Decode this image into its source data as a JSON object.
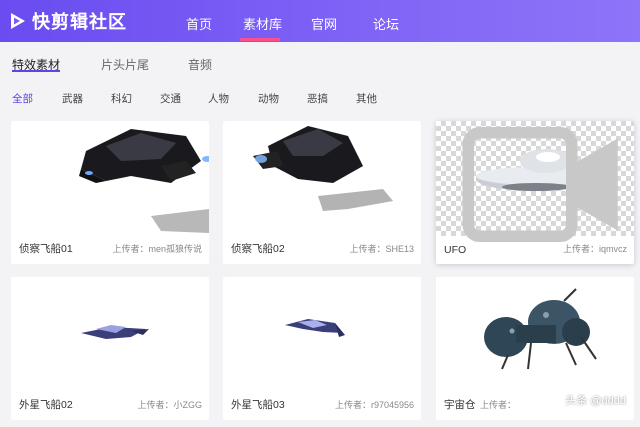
{
  "header": {
    "logo_text": "快剪辑社区",
    "nav": [
      {
        "label": "首页"
      },
      {
        "label": "素材库"
      },
      {
        "label": "官网"
      },
      {
        "label": "论坛"
      }
    ],
    "active_nav": "素材库"
  },
  "tabs": [
    {
      "label": "特效素材"
    },
    {
      "label": "片头片尾"
    },
    {
      "label": "音频"
    }
  ],
  "filters": [
    {
      "label": "全部"
    },
    {
      "label": "武器"
    },
    {
      "label": "科幻"
    },
    {
      "label": "交通"
    },
    {
      "label": "人物"
    },
    {
      "label": "动物"
    },
    {
      "label": "恶搞"
    },
    {
      "label": "其他"
    }
  ],
  "cards": [
    {
      "title": "侦察飞船01",
      "uploader": "上传者：men孤狼传说"
    },
    {
      "title": "侦察飞船02",
      "uploader": "上传者：SHE13"
    },
    {
      "title": "UFO",
      "uploader": "上传者：iqmvcz"
    },
    {
      "title": "外星飞船02",
      "uploader": "上传者：小ZGG"
    },
    {
      "title": "外星飞船03",
      "uploader": "上传者：r97045956"
    },
    {
      "title": "宇宙仓",
      "uploader": "上传者：",
      "watermark": "头条 @dddd"
    }
  ],
  "colors": {
    "accent": "#5b46e8",
    "header_start": "#6a4cf0",
    "header_end": "#8e74f8",
    "nav_underline": "#ff4f8b"
  }
}
